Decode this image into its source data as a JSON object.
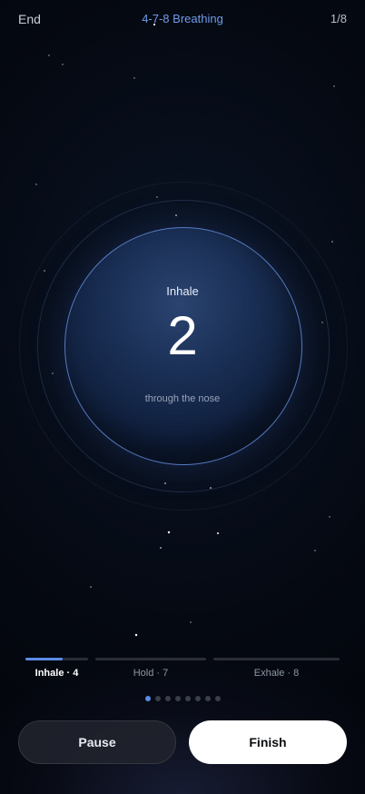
{
  "header": {
    "end_label": "End",
    "title": "4-7-8 Breathing",
    "counter": "1/8"
  },
  "breath": {
    "phase": "Inhale",
    "count": "2",
    "hint": "through the nose"
  },
  "progress": {
    "segments": [
      {
        "label": "Inhale · 4",
        "fill": 0.6,
        "active": true
      },
      {
        "label": "Hold · 7",
        "fill": 0,
        "active": false
      },
      {
        "label": "Exhale · 8",
        "fill": 0,
        "active": false
      }
    ]
  },
  "pager": {
    "total": 8,
    "current": 1
  },
  "actions": {
    "pause_label": "Pause",
    "finish_label": "Finish"
  },
  "colors": {
    "accent": "#5b8be6",
    "title": "#6f9bea",
    "background": "#050912"
  },
  "icons": []
}
